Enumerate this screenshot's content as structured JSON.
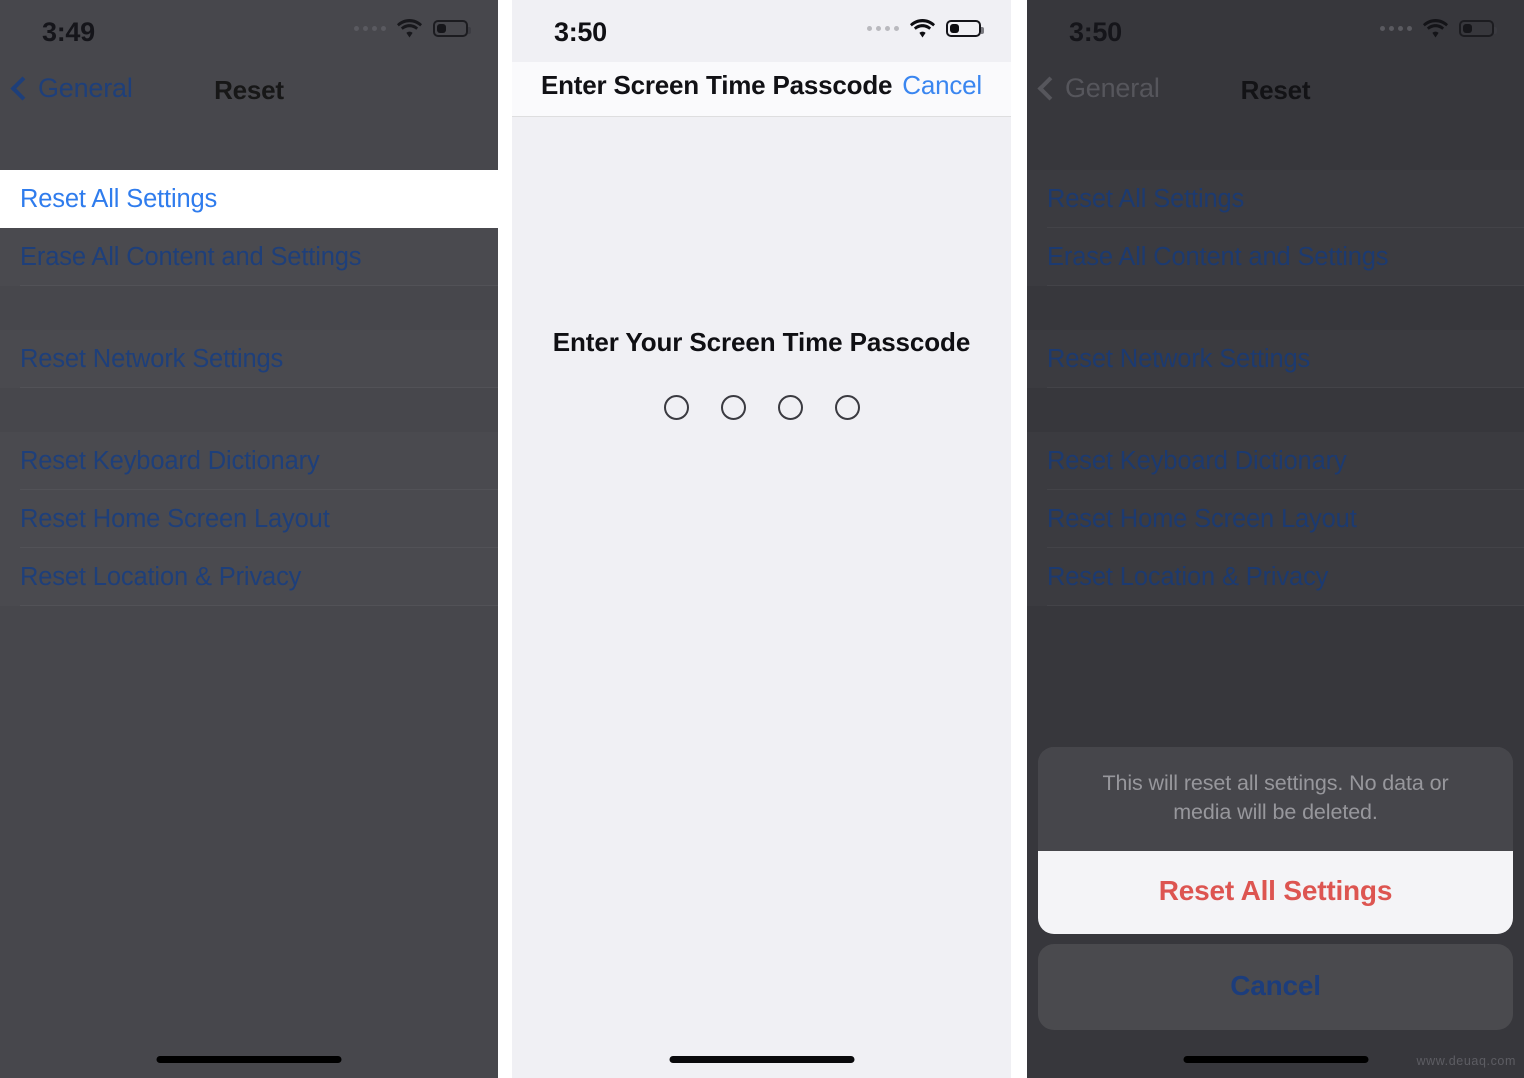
{
  "panels": {
    "left": {
      "status": {
        "time": "3:49",
        "signal_icon": "cellular-dots-icon",
        "wifi_icon": "wifi-icon",
        "battery_icon": "battery-low-icon"
      },
      "nav": {
        "back_label": "General",
        "back_icon": "chevron-left-icon",
        "title": "Reset"
      },
      "list": {
        "groups": [
          {
            "rows": [
              {
                "label": "Reset All Settings",
                "highlighted": true
              },
              {
                "label": "Erase All Content and Settings",
                "highlighted": false
              }
            ]
          },
          {
            "rows": [
              {
                "label": "Reset Network Settings",
                "highlighted": false
              }
            ]
          },
          {
            "rows": [
              {
                "label": "Reset Keyboard Dictionary",
                "highlighted": false
              },
              {
                "label": "Reset Home Screen Layout",
                "highlighted": false
              },
              {
                "label": "Reset Location & Privacy",
                "highlighted": false
              }
            ]
          }
        ]
      }
    },
    "middle": {
      "status": {
        "time": "3:50",
        "signal_icon": "cellular-dots-icon",
        "wifi_icon": "wifi-icon",
        "battery_icon": "battery-low-icon"
      },
      "header": {
        "title": "Enter Screen Time Passcode",
        "cancel_label": "Cancel"
      },
      "passcode": {
        "prompt": "Enter Your Screen Time Passcode",
        "digits": 4,
        "filled": 0
      }
    },
    "right": {
      "status": {
        "time": "3:50",
        "signal_icon": "cellular-dots-icon",
        "wifi_icon": "wifi-icon",
        "battery_icon": "battery-low-icon"
      },
      "nav": {
        "back_label": "General",
        "back_icon": "chevron-left-icon",
        "title": "Reset"
      },
      "list": {
        "groups": [
          {
            "rows": [
              {
                "label": "Reset All Settings",
                "highlighted": false
              },
              {
                "label": "Erase All Content and Settings",
                "highlighted": false
              }
            ]
          },
          {
            "rows": [
              {
                "label": "Reset Network Settings",
                "highlighted": false
              }
            ]
          },
          {
            "rows": [
              {
                "label": "Reset Keyboard Dictionary",
                "highlighted": false
              },
              {
                "label": "Reset Home Screen Layout",
                "highlighted": false
              },
              {
                "label": "Reset Location & Privacy",
                "highlighted": false
              }
            ]
          }
        ]
      },
      "action_sheet": {
        "message": "This will reset all settings. No data or media will be deleted.",
        "destructive_label": "Reset All Settings",
        "cancel_label": "Cancel"
      }
    }
  },
  "watermark": {
    "text": "www.deuaq.com"
  },
  "colors": {
    "ios_blue": "#2f7ced",
    "dim_blue": "#1e3f7a",
    "destructive_red": "#dd5551",
    "dim_overlay_light": "#47474c",
    "dim_overlay_dark": "#37373c",
    "sheet_gray": "#4a4a4e",
    "panel_light_bg": "#f0f0f4"
  }
}
